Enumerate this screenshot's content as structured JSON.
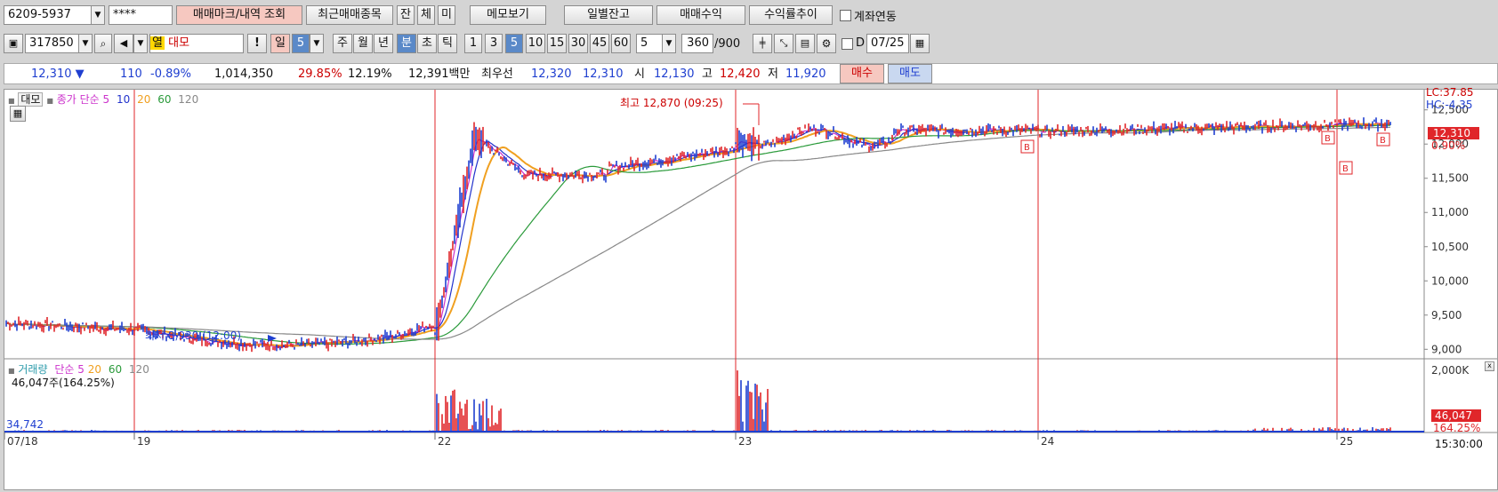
{
  "toolbar1": {
    "account": "6209-5937",
    "password": "****",
    "btn_trade_mark": "매매마크/내역 조회",
    "btn_recent": "최근매매종목",
    "btn_jan": "잔",
    "btn_che": "체",
    "btn_mi": "미",
    "btn_memo": "메모보기",
    "btn_daily": "일별잔고",
    "btn_profit": "매매수익",
    "btn_rate": "수익률추이",
    "link_label": "계좌연동"
  },
  "toolbar2": {
    "code": "317850",
    "name_tag": "열",
    "name": "대모",
    "period_day": "일",
    "period_day_n": "5",
    "period_week": "주",
    "period_month": "월",
    "period_year": "년",
    "period_min": "분",
    "period_sec": "초",
    "period_tick": "틱",
    "intervals": [
      "1",
      "3",
      "5",
      "10",
      "15",
      "30",
      "45",
      "60"
    ],
    "interval_custom": "5",
    "count": "360",
    "count_max": "/900",
    "d_label": "D",
    "date": "07/25"
  },
  "quote": {
    "price": "12,310 ▼",
    "change": "110",
    "change_pct": "-0.89%",
    "volume": "1,014,350",
    "vol_ratio": "29.85%",
    "turnover": "12.19%",
    "amount": "12,391백만",
    "best_label": "최우선",
    "best_ask": "12,320",
    "best_bid": "12,310",
    "open_label": "시",
    "open": "12,130",
    "high_label": "고",
    "high": "12,420",
    "low_label": "저",
    "low": "11,920",
    "buy": "매수",
    "sell": "매도"
  },
  "price_panel": {
    "stock": "대모",
    "ma_label": "종가 단순 5",
    "ma10": "10",
    "ma20": "20",
    "ma60": "60",
    "ma120": "120",
    "lc": "LC:37.85",
    "hc": "HC:-4.35",
    "cur_price": "12,310",
    "cur_pct": "0.90%",
    "high_note": "최고 12,870 (09:25)",
    "low_note": "최저 8,930 (12:00)",
    "buy_mark": "B",
    "y_ticks": [
      "12,500",
      "12,000",
      "11,500",
      "11,000",
      "10,500",
      "10,000",
      "9,500",
      "9,000"
    ]
  },
  "volume_panel": {
    "label": "거래량",
    "ma_label": "단순 5",
    "ma20": "20",
    "ma60": "60",
    "ma120": "120",
    "sel_vol": "46,047주(164.25%)",
    "left_val": "34,742",
    "y_tick": "2,000K",
    "cur_vol": "46,047",
    "cur_pct": "164.25%"
  },
  "x_axis": {
    "labels": [
      "07/18",
      "19",
      "22",
      "23",
      "24",
      "25"
    ],
    "time": "15:30:00"
  },
  "colors": {
    "up": "#e0262a",
    "down": "#1f3fd0",
    "ma5": "#cc33cc",
    "ma10": "#2233cc",
    "ma20": "#f0a020",
    "ma60": "#2a9a3a",
    "ma120": "#888888"
  }
}
